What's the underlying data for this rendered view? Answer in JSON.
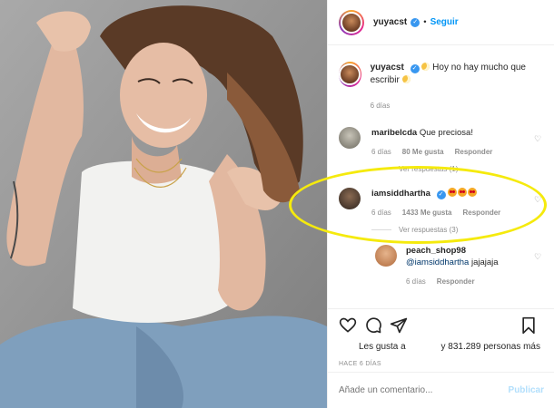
{
  "post": {
    "username": "yuyacst",
    "follow_label": "Seguir",
    "caption_text": "Hoy no hay mucho que escribir",
    "caption_time": "6 días"
  },
  "comments": [
    {
      "username": "maribelcda",
      "text": "Que preciosa!",
      "time": "6 días",
      "likes": "80 Me gusta",
      "reply": "Responder",
      "view_replies": "Ver respuestas (1)"
    },
    {
      "username": "iamsiddhartha",
      "text": "",
      "time": "6 días",
      "likes": "1433 Me gusta",
      "reply": "Responder",
      "view_replies": "Ver respuestas (3)"
    }
  ],
  "reply": {
    "username": "peach_shop98",
    "mention": "@iamsiddhartha",
    "text": "jajajaja",
    "time": "6 días",
    "reply": "Responder"
  },
  "actions": {
    "likes_label": "Les gusta a",
    "likes_count": "y 831.289 personas más",
    "timestamp": "HACE 6 DÍAS"
  },
  "add_comment": {
    "placeholder": "Añade un comentario...",
    "publish_label": "Publicar"
  },
  "colors": {
    "accent": "#0095f6",
    "highlight": "#f5ea0d",
    "verified": "#3897f0"
  },
  "icons": [
    "verified-icon",
    "heart-icon",
    "comment-icon",
    "share-icon",
    "bookmark-icon"
  ]
}
